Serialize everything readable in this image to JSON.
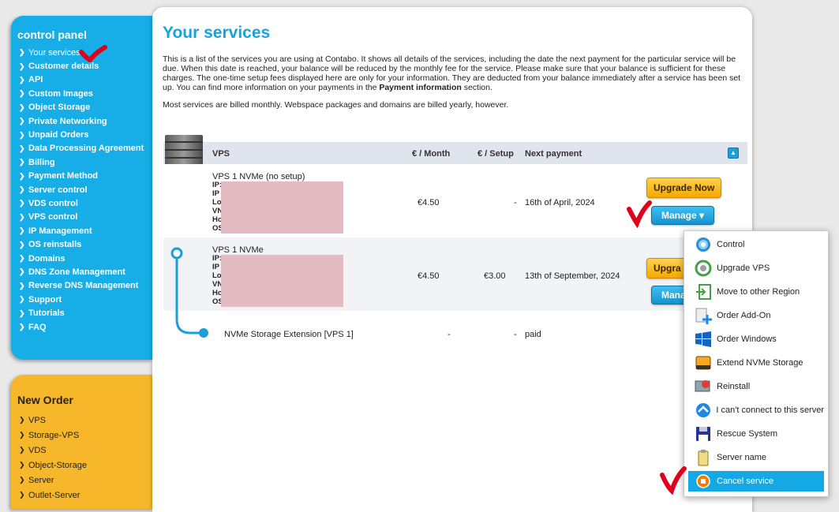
{
  "sidebar": {
    "title": "control panel",
    "items": [
      {
        "label": "Your services"
      },
      {
        "label": "Customer details"
      },
      {
        "label": "API"
      },
      {
        "label": "Custom Images"
      },
      {
        "label": "Object Storage"
      },
      {
        "label": "Private Networking"
      },
      {
        "label": "Unpaid Orders"
      },
      {
        "label": "Data Processing Agreement"
      },
      {
        "label": "Billing"
      },
      {
        "label": "Payment Method"
      },
      {
        "label": "Server control"
      },
      {
        "label": "VDS control"
      },
      {
        "label": "VPS control"
      },
      {
        "label": "IP Management"
      },
      {
        "label": "OS reinstalls"
      },
      {
        "label": "Domains"
      },
      {
        "label": "DNS Zone Management"
      },
      {
        "label": "Reverse DNS Management"
      },
      {
        "label": "Support"
      },
      {
        "label": "Tutorials"
      },
      {
        "label": "FAQ"
      }
    ]
  },
  "new_order": {
    "title": "New Order",
    "items": [
      {
        "label": "VPS"
      },
      {
        "label": "Storage-VPS"
      },
      {
        "label": "VDS"
      },
      {
        "label": "Object-Storage"
      },
      {
        "label": "Server"
      },
      {
        "label": "Outlet-Server"
      }
    ]
  },
  "main": {
    "title": "Your services",
    "intro_pre": "This is a list of the services you are using at Contabo. It shows all details of the services, including the date the next payment for the particular service will be due. When this date is reached, your balance will be reduced by the monthly fee for the service. Please make sure that your balance is sufficient for these charges. The one-time setup fees displayed here are only for your information. They are deducted from your balance immediately after a service has been set up. You can find more information on your payments in the ",
    "intro_bold": "Payment information",
    "intro_post": " section.",
    "intro2": "Most services are billed monthly. Webspace packages and domains are billed yearly, however."
  },
  "table": {
    "headers": {
      "product": "VPS",
      "month": "€ / Month",
      "setup": "€ / Setup",
      "next": "Next payment"
    },
    "rows": [
      {
        "name": "VPS 1 NVMe (no setup)",
        "detail_lines": [
          "IP:",
          "IP",
          "Lo",
          "VN",
          "Ho",
          "OS"
        ],
        "month": "€4.50",
        "setup": "-",
        "next": "16th of April, 2024",
        "upgrade_label": "Upgrade Now",
        "manage_label": "Manage"
      },
      {
        "name": "VPS 1 NVMe",
        "detail_lines": [
          "IP:",
          "IP",
          "Lo",
          "VN",
          "Ho",
          "OS"
        ],
        "month": "€4.50",
        "setup": "€3.00",
        "next": "13th of September, 2024",
        "upgrade_label": "Upgra",
        "manage_label": "Mana"
      },
      {
        "name": "NVMe Storage Extension [VPS 1]",
        "month": "-",
        "setup": "-",
        "next": "paid"
      }
    ]
  },
  "dropdown": {
    "items": [
      {
        "label": "Control",
        "icon": "gear-icon"
      },
      {
        "label": "Upgrade VPS",
        "icon": "upgrade-icon"
      },
      {
        "label": "Move to other Region",
        "icon": "move-region-icon"
      },
      {
        "label": "Order Add-On",
        "icon": "addon-icon"
      },
      {
        "label": "Order Windows",
        "icon": "windows-icon"
      },
      {
        "label": "Extend NVMe Storage",
        "icon": "storage-icon"
      },
      {
        "label": "Reinstall",
        "icon": "reinstall-icon"
      },
      {
        "label": "I can't connect to this server",
        "icon": "connect-icon"
      },
      {
        "label": "Rescue System",
        "icon": "floppy-icon"
      },
      {
        "label": "Server name",
        "icon": "tag-icon"
      },
      {
        "label": "Cancel service",
        "icon": "cancel-icon"
      }
    ],
    "selected_index": 10
  },
  "colors": {
    "accent_blue": "#17aee8",
    "accent_orange": "#f7b72a",
    "check_red": "#e0001b",
    "redaction": "#e2bcc2"
  }
}
